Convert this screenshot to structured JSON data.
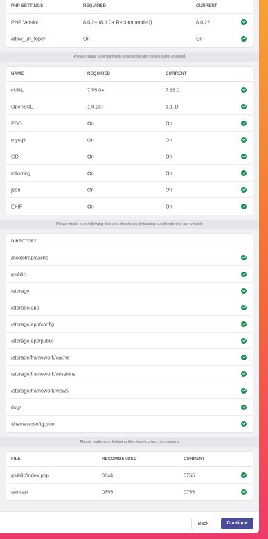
{
  "php_table": {
    "headers": [
      "PHP SETTINGS",
      "REQUIRED",
      "CURRENT"
    ],
    "rows": [
      {
        "name": "PHP Version",
        "required": "8.0.2+ (8.1.0+ Recommended)",
        "current": "8.0.22"
      },
      {
        "name": "allow_url_fopen",
        "required": "On",
        "current": "On"
      }
    ]
  },
  "extensions_notice": "Please make sure following extensions are installed and enabled",
  "extensions_table": {
    "headers": [
      "NAME",
      "REQUIRED",
      "CURRENT"
    ],
    "rows": [
      {
        "name": "cURL",
        "required": "7.55.0+",
        "current": "7.68.0"
      },
      {
        "name": "OpenSSL",
        "required": "1.0.2k+",
        "current": "1.1.1f"
      },
      {
        "name": "PDO",
        "required": "On",
        "current": "On"
      },
      {
        "name": "mysqli",
        "required": "On",
        "current": "On"
      },
      {
        "name": "GD",
        "required": "On",
        "current": "On"
      },
      {
        "name": "mbstring",
        "required": "On",
        "current": "On"
      },
      {
        "name": "json",
        "required": "On",
        "current": "On"
      },
      {
        "name": "EXIF",
        "required": "On",
        "current": "On"
      }
    ]
  },
  "directories_notice": "Please make sure following files and directories (including subdirectories) are writable",
  "directories_table": {
    "headers": [
      "DIRECTORY"
    ],
    "rows": [
      {
        "name": "/bootstrap/cache"
      },
      {
        "name": "/public"
      },
      {
        "name": "/storage"
      },
      {
        "name": "/storage/app"
      },
      {
        "name": "/storage/app/config"
      },
      {
        "name": "/storage/app/public"
      },
      {
        "name": "/storage/framework/cache"
      },
      {
        "name": "/storage/framework/sessions"
      },
      {
        "name": "/storage/framework/views"
      },
      {
        "name": "/logs"
      },
      {
        "name": "/themes/config.json"
      }
    ]
  },
  "permissions_notice": "Please make sure following files have correct permissions",
  "permissions_table": {
    "headers": [
      "FILE",
      "RECOMMENDED",
      "CURRENT"
    ],
    "rows": [
      {
        "name": "/public/index.php",
        "required": "0644",
        "current": "0755"
      },
      {
        "name": "/artisan",
        "required": "0755",
        "current": "0755"
      }
    ]
  },
  "footer": {
    "back_label": "Back",
    "continue_label": "Continue"
  },
  "colors": {
    "check_green": "#1e8a52",
    "continue_button": "#4a4b9a"
  },
  "icons": {
    "status": "check-circle-icon"
  }
}
